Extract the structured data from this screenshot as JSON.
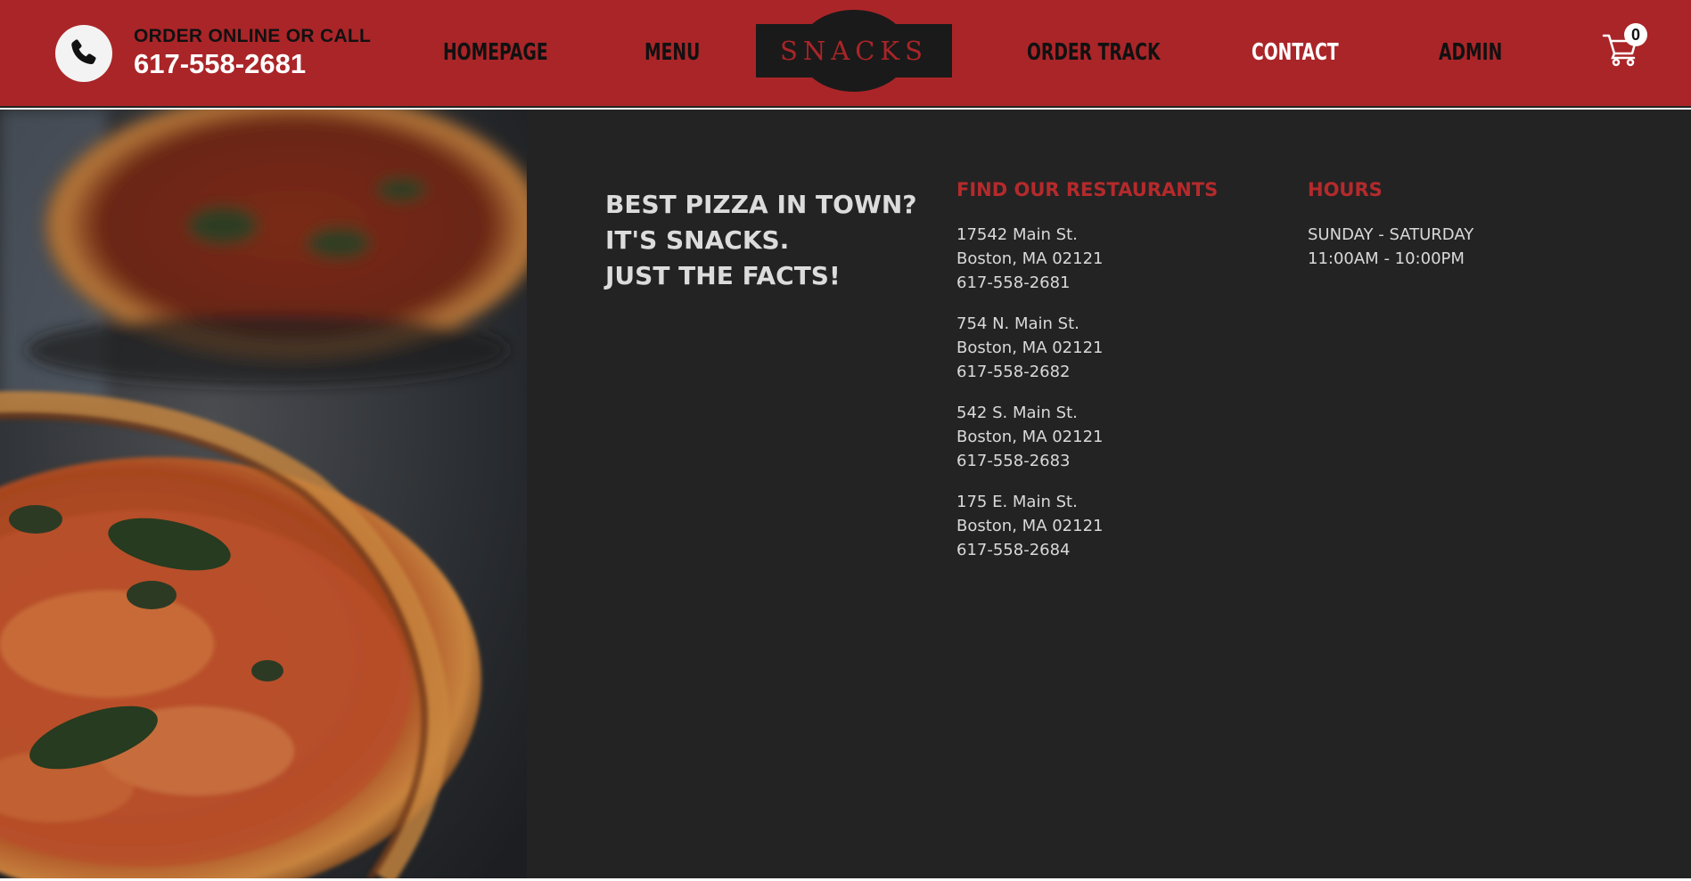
{
  "header": {
    "call_label": "ORDER ONLINE OR CALL",
    "call_number": "617-558-2681",
    "phone_icon": "phone-icon",
    "logo": "SNACKS",
    "nav": [
      {
        "label": "HOMEPAGE",
        "active": false
      },
      {
        "label": "MENU",
        "active": false
      },
      {
        "label": "ORDER TRACK",
        "active": false
      },
      {
        "label": "CONTACT",
        "active": true
      },
      {
        "label": "ADMIN",
        "active": false
      }
    ],
    "cart": {
      "icon": "cart-icon",
      "count": "0"
    }
  },
  "hero": {
    "image": "pizza-photo"
  },
  "footer": {
    "tagline": [
      "BEST PIZZA IN TOWN?",
      "IT'S SNACKS.",
      "JUST THE FACTS!"
    ],
    "restaurants_title": "FIND OUR RESTAURANTS",
    "restaurants": [
      {
        "street": "17542 Main St.",
        "city": "Boston, MA 02121",
        "phone": "617-558-2681"
      },
      {
        "street": "754 N. Main St.",
        "city": "Boston, MA 02121",
        "phone": "617-558-2682"
      },
      {
        "street": "542 S. Main St.",
        "city": "Boston, MA 02121",
        "phone": "617-558-2683"
      },
      {
        "street": "175 E. Main St.",
        "city": "Boston, MA 02121",
        "phone": "617-558-2684"
      }
    ],
    "hours_title": "HOURS",
    "hours_days": "SUNDAY - SATURDAY",
    "hours_time": "11:00AM - 10:00PM"
  },
  "colors": {
    "brand_red": "#aa2528",
    "panel_dark": "#232323",
    "heading_red": "#b52a2c",
    "text_light": "#d9d9d9"
  }
}
